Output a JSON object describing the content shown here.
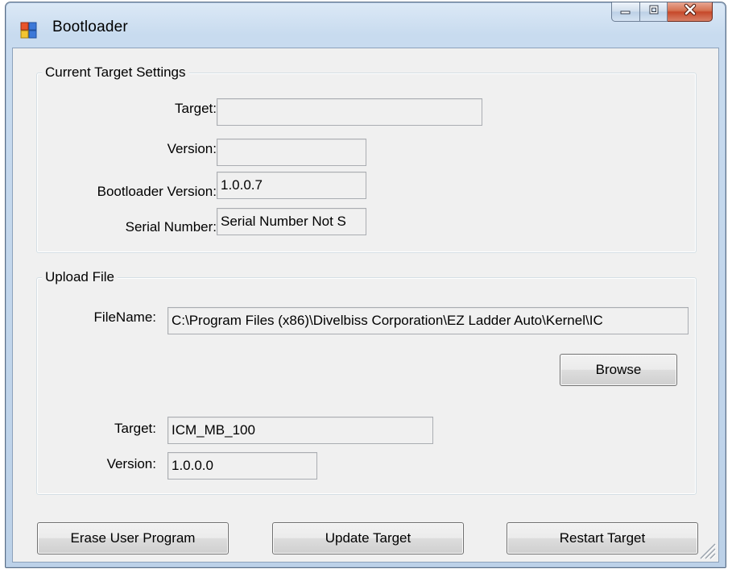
{
  "window": {
    "title": "Bootloader"
  },
  "current_target_settings": {
    "legend": "Current Target Settings",
    "target_label": "Target:",
    "target_value": "",
    "version_label": "Version:",
    "version_value": "",
    "bootloader_version_label": "Bootloader Version:",
    "bootloader_version_value": "1.0.0.7",
    "serial_number_label": "Serial Number:",
    "serial_number_value": "Serial Number Not S"
  },
  "upload_file": {
    "legend": "Upload File",
    "filename_label": "FileName:",
    "filename_value": "C:\\Program Files (x86)\\Divelbiss Corporation\\EZ Ladder Auto\\Kernel\\IC",
    "browse_label": "Browse",
    "target_label": "Target:",
    "target_value": "ICM_MB_100",
    "version_label": "Version:",
    "version_value": "1.0.0.0"
  },
  "actions": {
    "erase_label": "Erase User Program",
    "update_label": "Update Target",
    "restart_label": "Restart Target"
  },
  "icons": {
    "app": "app-window-icon",
    "minimize": "minimize-icon",
    "maximize": "maximize-icon",
    "close": "close-icon",
    "resize": "resize-grip-icon"
  },
  "colors": {
    "titlebar": "#c8dbef",
    "client_background": "#f0f0f0",
    "close_button": "#c6482a"
  }
}
